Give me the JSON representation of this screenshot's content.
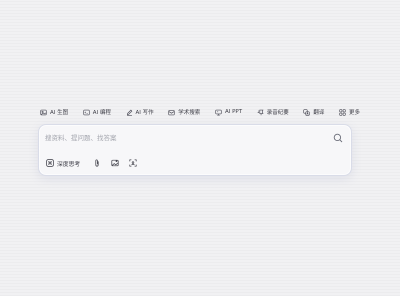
{
  "toolbar": {
    "items": [
      {
        "label": "AI 生图",
        "icon": "image-icon"
      },
      {
        "label": "AI 编程",
        "icon": "code-icon"
      },
      {
        "label": "AI 写作",
        "icon": "pen-icon"
      },
      {
        "label": "学术搜索",
        "icon": "book-icon"
      },
      {
        "label": "AI PPT",
        "icon": "presentation-icon"
      },
      {
        "label": "录音纪要",
        "icon": "microphone-icon"
      },
      {
        "label": "翻译",
        "icon": "translate-icon"
      },
      {
        "label": "更多",
        "icon": "grid-icon"
      }
    ]
  },
  "search": {
    "placeholder": "搜资料、提问题、找答案"
  },
  "options": {
    "deep_think_label": "深度思考"
  }
}
